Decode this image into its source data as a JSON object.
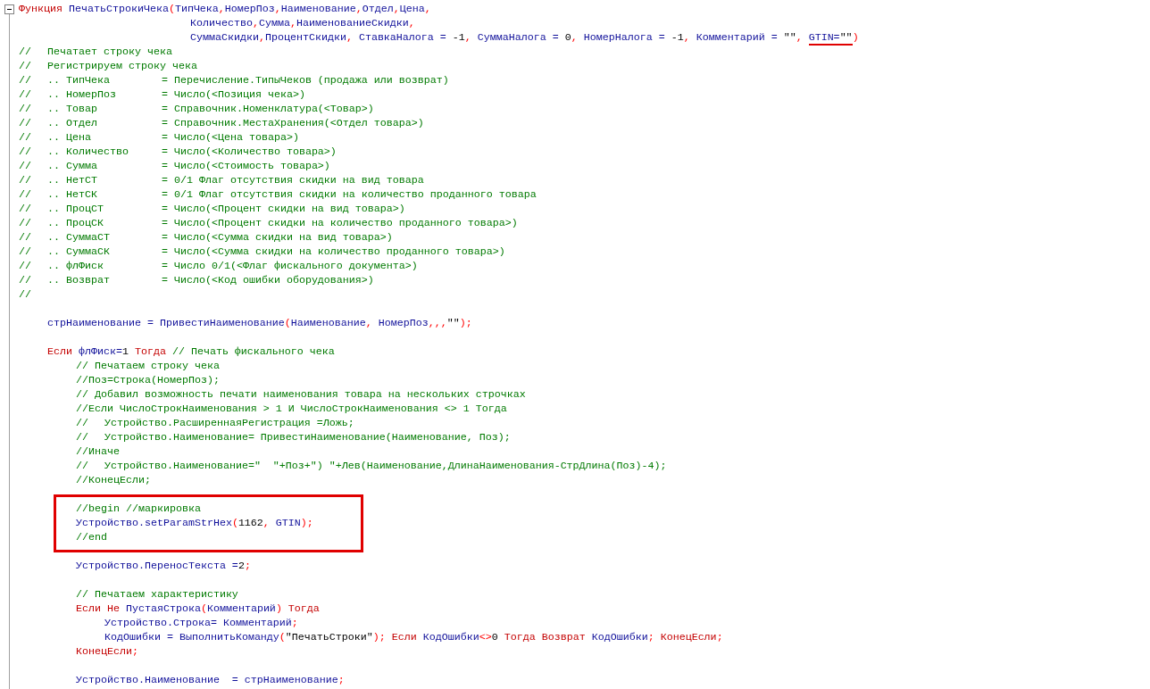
{
  "editor": {
    "lines": [
      {
        "kind": "code",
        "tokens": [
          {
            "kind": "keyword",
            "text": "Функция "
          },
          {
            "kind": "ident",
            "text": "ПечатьСтрокиЧека"
          },
          {
            "kind": "punct",
            "text": "("
          },
          {
            "kind": "ident",
            "text": "ТипЧека"
          },
          {
            "kind": "punct",
            "text": ","
          },
          {
            "kind": "ident",
            "text": "НомерПоз"
          },
          {
            "kind": "punct",
            "text": ","
          },
          {
            "kind": "ident",
            "text": "Наименование"
          },
          {
            "kind": "punct",
            "text": ","
          },
          {
            "kind": "ident",
            "text": "Отдел"
          },
          {
            "kind": "punct",
            "text": ","
          },
          {
            "kind": "ident",
            "text": "Цена"
          },
          {
            "kind": "punct",
            "text": ","
          }
        ]
      },
      {
        "kind": "code",
        "tokens": [
          {
            "kind": "ident",
            "text": "\t\t\t\t\t\tКоличество"
          },
          {
            "kind": "punct",
            "text": ","
          },
          {
            "kind": "ident",
            "text": "Сумма"
          },
          {
            "kind": "punct",
            "text": ","
          },
          {
            "kind": "ident",
            "text": "НаименованиеСкидки"
          },
          {
            "kind": "punct",
            "text": ","
          }
        ]
      },
      {
        "kind": "code",
        "tokens": [
          {
            "kind": "ident",
            "text": "\t\t\t\t\t\tСуммаСкидки",
            "underlined": false
          },
          {
            "kind": "punct",
            "text": ",",
            "underlined": false
          },
          {
            "kind": "ident",
            "text": "ПроцентСкидки",
            "underlined": false
          },
          {
            "kind": "punct",
            "text": ", ",
            "underlined": false
          },
          {
            "kind": "ident",
            "text": "СтавкаНалога = ",
            "underlined": false
          },
          {
            "kind": "literal",
            "text": "-1",
            "underlined": false
          },
          {
            "kind": "punct",
            "text": ", ",
            "underlined": false
          },
          {
            "kind": "ident",
            "text": "СуммаНалога = ",
            "underlined": false
          },
          {
            "kind": "literal",
            "text": "0",
            "underlined": false
          },
          {
            "kind": "punct",
            "text": ", ",
            "underlined": false
          },
          {
            "kind": "ident",
            "text": "НомерНалога = ",
            "underlined": false
          },
          {
            "kind": "literal",
            "text": "-1",
            "underlined": false
          },
          {
            "kind": "punct",
            "text": ", ",
            "underlined": false
          },
          {
            "kind": "ident",
            "text": "Комментарий = ",
            "underlined": false
          },
          {
            "kind": "literal",
            "text": "\"\"",
            "underlined": false
          },
          {
            "kind": "punct",
            "text": ", ",
            "underlined": false
          },
          {
            "kind": "ident",
            "text": "GTIN=",
            "underlined": true
          },
          {
            "kind": "literal",
            "text": "\"\"",
            "underlined": true
          },
          {
            "kind": "punct",
            "text": ")",
            "underlined": false
          }
        ]
      },
      {
        "kind": "code",
        "tokens": [
          {
            "kind": "comment",
            "text": "//\tПечатает строку чека"
          }
        ]
      },
      {
        "kind": "code",
        "tokens": [
          {
            "kind": "comment",
            "text": "//\tРегистрируем строку чека"
          }
        ]
      },
      {
        "kind": "code",
        "tokens": [
          {
            "kind": "comment",
            "text": "//\t.. ТипЧека\t\t= Перечисление.ТипыЧеков (продажа или возврат)"
          }
        ]
      },
      {
        "kind": "code",
        "tokens": [
          {
            "kind": "comment",
            "text": "//\t.. НомерПоз\t\t= Число(<Позиция чека>)"
          }
        ]
      },
      {
        "kind": "code",
        "tokens": [
          {
            "kind": "comment",
            "text": "//\t.. Товар\t\t\t= Справочник.Номенклатура(<Товар>)"
          }
        ]
      },
      {
        "kind": "code",
        "tokens": [
          {
            "kind": "comment",
            "text": "//\t.. Отдел\t\t\t= Справочник.МестаХранения(<Отдел товара>)"
          }
        ]
      },
      {
        "kind": "code",
        "tokens": [
          {
            "kind": "comment",
            "text": "//\t.. Цена\t\t\t= Число(<Цена товара>)"
          }
        ]
      },
      {
        "kind": "code",
        "tokens": [
          {
            "kind": "comment",
            "text": "//\t.. Количество\t\t= Число(<Количество товара>)"
          }
        ]
      },
      {
        "kind": "code",
        "tokens": [
          {
            "kind": "comment",
            "text": "//\t.. Сумма\t\t\t= Число(<Стоимость товара>)"
          }
        ]
      },
      {
        "kind": "code",
        "tokens": [
          {
            "kind": "comment",
            "text": "//\t.. НетСТ\t\t\t= 0/1 Флаг отсутствия скидки на вид товара"
          }
        ]
      },
      {
        "kind": "code",
        "tokens": [
          {
            "kind": "comment",
            "text": "//\t.. НетСК\t\t\t= 0/1 Флаг отсутствия скидки на количество проданного товара"
          }
        ]
      },
      {
        "kind": "code",
        "tokens": [
          {
            "kind": "comment",
            "text": "//\t.. ПроцСТ\t\t= Число(<Процент скидки на вид товара>)"
          }
        ]
      },
      {
        "kind": "code",
        "tokens": [
          {
            "kind": "comment",
            "text": "//\t.. ПроцСК\t\t= Число(<Процент скидки на количество проданного товара>)"
          }
        ]
      },
      {
        "kind": "code",
        "tokens": [
          {
            "kind": "comment",
            "text": "//\t.. СуммаСТ\t\t= Число(<Сумма скидки на вид товара>)"
          }
        ]
      },
      {
        "kind": "code",
        "tokens": [
          {
            "kind": "comment",
            "text": "//\t.. СуммаСК\t\t= Число(<Сумма скидки на количество проданного товара>)"
          }
        ]
      },
      {
        "kind": "code",
        "tokens": [
          {
            "kind": "comment",
            "text": "//\t.. флФиск\t\t= Число 0/1(<Флаг фискального документа>)"
          }
        ]
      },
      {
        "kind": "code",
        "tokens": [
          {
            "kind": "comment",
            "text": "//\t.. Возврат\t\t= Число(<Код ошибки оборудования>)"
          }
        ]
      },
      {
        "kind": "code",
        "tokens": [
          {
            "kind": "comment",
            "text": "//"
          }
        ]
      },
      {
        "kind": "blank"
      },
      {
        "kind": "code",
        "tokens": [
          {
            "kind": "ident",
            "text": "\tстрНаименование = ПривестиНаименование"
          },
          {
            "kind": "punct",
            "text": "("
          },
          {
            "kind": "ident",
            "text": "Наименование"
          },
          {
            "kind": "punct",
            "text": ", "
          },
          {
            "kind": "ident",
            "text": "НомерПоз"
          },
          {
            "kind": "punct",
            "text": ",,,"
          },
          {
            "kind": "literal",
            "text": "\"\""
          },
          {
            "kind": "punct",
            "text": ");"
          }
        ]
      },
      {
        "kind": "blank"
      },
      {
        "kind": "code",
        "tokens": [
          {
            "kind": "keyword",
            "text": "\tЕсли "
          },
          {
            "kind": "ident",
            "text": "флФиск="
          },
          {
            "kind": "literal",
            "text": "1"
          },
          {
            "kind": "keyword",
            "text": " Тогда "
          },
          {
            "kind": "comment",
            "text": "// Печать фискального чека"
          }
        ]
      },
      {
        "kind": "code",
        "tokens": [
          {
            "kind": "comment",
            "text": "\t\t// Печатаем строку чека"
          }
        ]
      },
      {
        "kind": "code",
        "tokens": [
          {
            "kind": "comment",
            "text": "\t\t//Поз=Строка(НомерПоз);"
          }
        ]
      },
      {
        "kind": "code",
        "tokens": [
          {
            "kind": "comment",
            "text": "\t\t// Добавил возможность печати наименования товара на нескольких строчках"
          }
        ]
      },
      {
        "kind": "code",
        "tokens": [
          {
            "kind": "comment",
            "text": "\t\t//Если ЧислоСтрокНаименования > 1 И ЧислоСтрокНаименования <> 1 Тогда"
          }
        ]
      },
      {
        "kind": "code",
        "tokens": [
          {
            "kind": "comment",
            "text": "\t\t//\tУстройство.РасширеннаяРегистрация =Ложь;"
          }
        ]
      },
      {
        "kind": "code",
        "tokens": [
          {
            "kind": "comment",
            "text": "\t\t//\tУстройство.Наименование= ПривестиНаименование(Наименование, Поз);"
          }
        ]
      },
      {
        "kind": "code",
        "tokens": [
          {
            "kind": "comment",
            "text": "\t\t//Иначе"
          }
        ]
      },
      {
        "kind": "code",
        "tokens": [
          {
            "kind": "comment",
            "text": "\t\t//\tУстройство.Наименование=\"  \"+Поз+\") \"+Лев(Наименование,ДлинаНаименования-СтрДлина(Поз)-4);"
          }
        ]
      },
      {
        "kind": "code",
        "tokens": [
          {
            "kind": "comment",
            "text": "\t\t//КонецЕсли;"
          }
        ]
      },
      {
        "kind": "box",
        "lines": [
          {
            "kind": "blank"
          },
          {
            "kind": "code",
            "tokens": [
              {
                "kind": "comment",
                "text": "\t\t//begin //маркировка"
              }
            ]
          },
          {
            "kind": "code",
            "tokens": [
              {
                "kind": "ident",
                "text": "\t\tУстройство.setParamStrHex"
              },
              {
                "kind": "punct",
                "text": "("
              },
              {
                "kind": "literal",
                "text": "1162"
              },
              {
                "kind": "punct",
                "text": ", "
              },
              {
                "kind": "ident",
                "text": "GTIN"
              },
              {
                "kind": "punct",
                "text": ");"
              }
            ]
          },
          {
            "kind": "code",
            "tokens": [
              {
                "kind": "comment",
                "text": "\t\t//end"
              }
            ]
          },
          {
            "kind": "blank"
          }
        ]
      },
      {
        "kind": "code",
        "tokens": [
          {
            "kind": "ident",
            "text": "\t\tУстройство.ПереносТекста ="
          },
          {
            "kind": "literal",
            "text": "2"
          },
          {
            "kind": "punct",
            "text": ";"
          }
        ]
      },
      {
        "kind": "blank"
      },
      {
        "kind": "code",
        "tokens": [
          {
            "kind": "comment",
            "text": "\t\t// Печатаем характеристику"
          }
        ]
      },
      {
        "kind": "code",
        "tokens": [
          {
            "kind": "keyword",
            "text": "\t\tЕсли Не "
          },
          {
            "kind": "ident",
            "text": "ПустаяСтрока"
          },
          {
            "kind": "punct",
            "text": "("
          },
          {
            "kind": "ident",
            "text": "Комментарий"
          },
          {
            "kind": "punct",
            "text": ")"
          },
          {
            "kind": "keyword",
            "text": " Тогда"
          }
        ]
      },
      {
        "kind": "code",
        "tokens": [
          {
            "kind": "ident",
            "text": "\t\t\tУстройство.Строка= Комментарий"
          },
          {
            "kind": "punct",
            "text": ";"
          }
        ]
      },
      {
        "kind": "code",
        "tokens": [
          {
            "kind": "ident",
            "text": "\t\t\tКодОшибки = ВыполнитьКоманду"
          },
          {
            "kind": "punct",
            "text": "("
          },
          {
            "kind": "literal",
            "text": "\"ПечатьСтроки\""
          },
          {
            "kind": "punct",
            "text": "); "
          },
          {
            "kind": "keyword",
            "text": "Если "
          },
          {
            "kind": "ident",
            "text": "КодОшибки"
          },
          {
            "kind": "punct",
            "text": "<>"
          },
          {
            "kind": "literal",
            "text": "0"
          },
          {
            "kind": "keyword",
            "text": " Тогда Возврат "
          },
          {
            "kind": "ident",
            "text": "КодОшибки"
          },
          {
            "kind": "punct",
            "text": "; "
          },
          {
            "kind": "keyword",
            "text": "КонецЕсли"
          },
          {
            "kind": "punct",
            "text": ";"
          }
        ]
      },
      {
        "kind": "code",
        "tokens": [
          {
            "kind": "keyword",
            "text": "\t\tКонецЕсли"
          },
          {
            "kind": "punct",
            "text": ";"
          }
        ]
      },
      {
        "kind": "blank"
      },
      {
        "kind": "code",
        "tokens": [
          {
            "kind": "ident",
            "text": "\t\tУстройство.Наименование  = стрНаименование"
          },
          {
            "kind": "punct",
            "text": ";"
          }
        ]
      }
    ]
  }
}
